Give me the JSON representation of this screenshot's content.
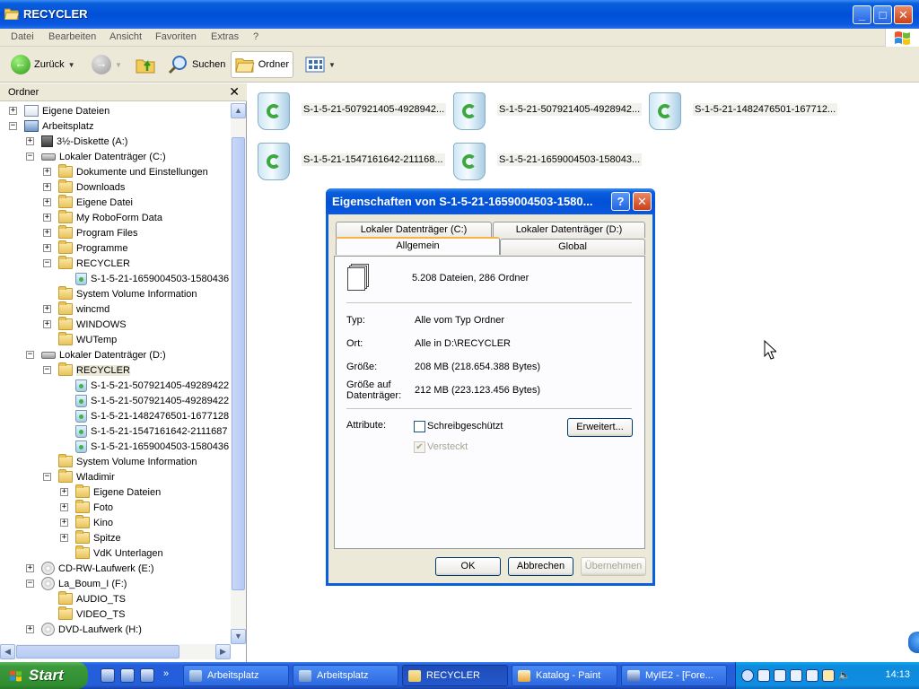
{
  "window": {
    "title": "RECYCLER",
    "controls": {
      "minimize": "_",
      "maximize": "□",
      "close": "✕"
    }
  },
  "menu": [
    "Datei",
    "Bearbeiten",
    "Ansicht",
    "Favoriten",
    "Extras",
    "?"
  ],
  "toolbar": {
    "back": "Zurück",
    "search": "Suchen",
    "folders": "Ordner"
  },
  "folder_pane": {
    "title": "Ordner",
    "close": "✕",
    "tree": [
      {
        "label": "Eigene Dateien",
        "icon": "my-documents",
        "depth": 0,
        "expander": "+"
      },
      {
        "label": "Arbeitsplatz",
        "icon": "my-computer",
        "depth": 0,
        "expander": "−"
      },
      {
        "label": "3½-Diskette (A:)",
        "icon": "floppy",
        "depth": 1,
        "expander": "+"
      },
      {
        "label": "Lokaler Datenträger (C:)",
        "icon": "drive",
        "depth": 1,
        "expander": "−"
      },
      {
        "label": "Dokumente und Einstellungen",
        "icon": "folder",
        "depth": 2,
        "expander": "+"
      },
      {
        "label": "Downloads",
        "icon": "folder",
        "depth": 2,
        "expander": "+"
      },
      {
        "label": "Eigene Datei",
        "icon": "folder",
        "depth": 2,
        "expander": "+"
      },
      {
        "label": "My RoboForm Data",
        "icon": "folder",
        "depth": 2,
        "expander": "+"
      },
      {
        "label": "Program Files",
        "icon": "folder",
        "depth": 2,
        "expander": "+"
      },
      {
        "label": "Programme",
        "icon": "folder",
        "depth": 2,
        "expander": "+"
      },
      {
        "label": "RECYCLER",
        "icon": "folder",
        "depth": 2,
        "expander": "−"
      },
      {
        "label": "S-1-5-21-1659004503-1580436",
        "icon": "recycle-bin",
        "depth": 3,
        "expander": ""
      },
      {
        "label": "System Volume Information",
        "icon": "folder",
        "depth": 2,
        "expander": ""
      },
      {
        "label": "wincmd",
        "icon": "folder",
        "depth": 2,
        "expander": "+"
      },
      {
        "label": "WINDOWS",
        "icon": "folder",
        "depth": 2,
        "expander": "+"
      },
      {
        "label": "WUTemp",
        "icon": "folder",
        "depth": 2,
        "expander": ""
      },
      {
        "label": "Lokaler Datenträger (D:)",
        "icon": "drive",
        "depth": 1,
        "expander": "−"
      },
      {
        "label": "RECYCLER",
        "icon": "folder",
        "depth": 2,
        "expander": "−",
        "selected": true
      },
      {
        "label": "S-1-5-21-507921405-49289422",
        "icon": "recycle-bin",
        "depth": 3,
        "expander": ""
      },
      {
        "label": "S-1-5-21-507921405-49289422",
        "icon": "recycle-bin",
        "depth": 3,
        "expander": ""
      },
      {
        "label": "S-1-5-21-1482476501-1677128",
        "icon": "recycle-bin",
        "depth": 3,
        "expander": ""
      },
      {
        "label": "S-1-5-21-1547161642-2111687",
        "icon": "recycle-bin",
        "depth": 3,
        "expander": ""
      },
      {
        "label": "S-1-5-21-1659004503-1580436",
        "icon": "recycle-bin",
        "depth": 3,
        "expander": ""
      },
      {
        "label": "System Volume Information",
        "icon": "folder",
        "depth": 2,
        "expander": ""
      },
      {
        "label": "Wladimir",
        "icon": "folder",
        "depth": 2,
        "expander": "−"
      },
      {
        "label": "Eigene Dateien",
        "icon": "folder",
        "depth": 3,
        "expander": "+"
      },
      {
        "label": "Foto",
        "icon": "folder",
        "depth": 3,
        "expander": "+"
      },
      {
        "label": "Kino",
        "icon": "folder",
        "depth": 3,
        "expander": "+"
      },
      {
        "label": "Spitze",
        "icon": "folder",
        "depth": 3,
        "expander": "+"
      },
      {
        "label": "VdK Unterlagen",
        "icon": "folder",
        "depth": 3,
        "expander": ""
      },
      {
        "label": "CD-RW-Laufwerk (E:)",
        "icon": "cd-drive",
        "depth": 1,
        "expander": "+"
      },
      {
        "label": "La_Boum_I (F:)",
        "icon": "cd-drive",
        "depth": 1,
        "expander": "−"
      },
      {
        "label": "AUDIO_TS",
        "icon": "folder",
        "depth": 2,
        "expander": ""
      },
      {
        "label": "VIDEO_TS",
        "icon": "folder",
        "depth": 2,
        "expander": ""
      },
      {
        "label": "DVD-Laufwerk (H:)",
        "icon": "cd-drive",
        "depth": 1,
        "expander": "+"
      }
    ]
  },
  "content_items": [
    "S-1-5-21-507921405-4928942...",
    "S-1-5-21-507921405-4928942...",
    "S-1-5-21-1482476501-167712...",
    "S-1-5-21-1547161642-211168...",
    "S-1-5-21-1659004503-158043..."
  ],
  "dialog": {
    "title": "Eigenschaften von S-1-5-21-1659004503-1580...",
    "help": "?",
    "close": "✕",
    "tabs_back": [
      "Lokaler Datenträger (C:)",
      "Lokaler Datenträger (D:)"
    ],
    "tabs_front": [
      "Allgemein",
      "Global"
    ],
    "summary": "5.208 Dateien, 286 Ordner",
    "fields": [
      {
        "label": "Typ:",
        "value": "Alle vom Typ Ordner"
      },
      {
        "label": "Ort:",
        "value": "Alle in D:\\RECYCLER"
      },
      {
        "label": "Größe:",
        "value": "208 MB (218.654.388 Bytes)"
      },
      {
        "label": "Größe auf Datenträger:",
        "value": "212 MB (223.123.456 Bytes)"
      }
    ],
    "attributes_label": "Attribute:",
    "readonly": "Schreibgeschützt",
    "hidden": "Versteckt",
    "advanced": "Erweitert...",
    "ok": "OK",
    "cancel": "Abbrechen",
    "apply": "Übernehmen"
  },
  "taskbar": {
    "start": "Start",
    "tasks": [
      "Arbeitsplatz",
      "Arbeitsplatz",
      "RECYCLER",
      "Katalog - Paint",
      "MyIE2 - [Fore..."
    ],
    "active_task": 2,
    "overflow": "»",
    "language": "DE",
    "clock": "14:13"
  }
}
